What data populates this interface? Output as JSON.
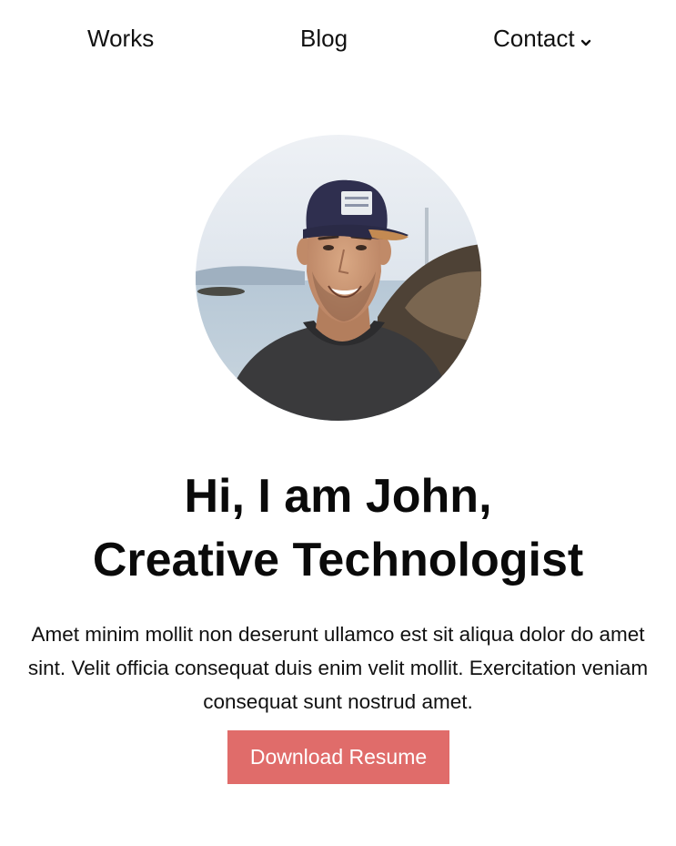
{
  "nav": {
    "items": [
      {
        "label": "Works"
      },
      {
        "label": "Blog"
      },
      {
        "label": "Contact",
        "icon": "chevron-down-icon"
      }
    ]
  },
  "profile": {
    "avatar": "profile-photo-man-in-navy-cap"
  },
  "hero": {
    "title_line1": "Hi, I am John,",
    "title_line2": "Creative Technologist",
    "description": "Amet minim mollit non deserunt ullamco est sit aliqua dolor do amet sint. Velit officia consequat duis enim velit mollit. Exercitation veniam consequat sunt nostrud amet.",
    "button_label": "Download Resume"
  },
  "colors": {
    "accent": "#e06c6a",
    "text": "#111111",
    "background": "#ffffff"
  }
}
